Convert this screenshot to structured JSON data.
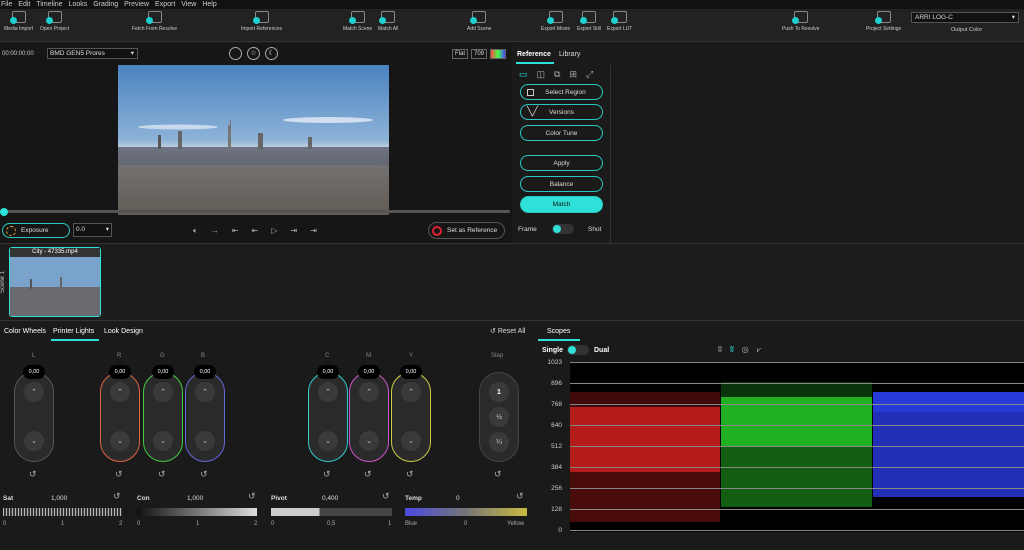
{
  "menu": [
    "File",
    "Edit",
    "Timeline",
    "Looks",
    "Grading",
    "Preview",
    "Export",
    "View",
    "Help"
  ],
  "toolbar": {
    "media_import": "Media Import",
    "open_project": "Open Project",
    "fetch": "Fetch From Resolve",
    "import_refs": "Import References",
    "match_scene": "Match Scene",
    "match_all": "Match All",
    "add_scene": "Add Scene",
    "export_movie": "Export Movie",
    "export_still": "Export Still",
    "export_lut": "Export LUT",
    "push": "Push To Resolve",
    "project_settings": "Project Settings",
    "output_color_value": "ARRI LOG-C",
    "output_color_label": "Output Color"
  },
  "viewer": {
    "timecode": "00:00:00:00",
    "format": "BMD GEN5 Prores",
    "flat": "Flat",
    "rec": "709",
    "exposure": "Exposure",
    "exposure_value": "0.0",
    "set_ref": "Set as Reference"
  },
  "ref": {
    "tab_reference": "Reference",
    "tab_library": "Library",
    "select_region": "Select Region",
    "versions": "Versions",
    "color_tune": "Color Tune",
    "apply": "Apply",
    "balance": "Balance",
    "match": "Match",
    "frame": "Frame",
    "shot": "Shot"
  },
  "clip": {
    "name": "City - 47335.mp4",
    "scene": "Scene 1"
  },
  "grading": {
    "tab_wheels": "Color Wheels",
    "tab_printer": "Printer Lights",
    "tab_look": "Look Design",
    "reset_all": "Reset All",
    "l": "L",
    "r": "R",
    "g": "G",
    "b": "B",
    "c": "C",
    "m": "M",
    "y": "Y",
    "step": "Step",
    "zero": "0,00",
    "step1": "1",
    "step2": "½",
    "step3": "¼",
    "sat": "Sat",
    "sat_val": "1,000",
    "con": "Con",
    "con_val": "1,000",
    "pivot": "Pivot",
    "pivot_val": "0,400",
    "temp": "Temp",
    "temp_val": "0",
    "t0": "0",
    "t1": "1",
    "t2": "2",
    "p0": "0",
    "p05": "0,5",
    "p1": "1",
    "blue": "Blue",
    "yellow": "Yellow"
  },
  "scopes": {
    "tab": "Scopes",
    "single": "Single",
    "dual": "Dual",
    "labels": [
      "1023",
      "896",
      "768",
      "640",
      "512",
      "384",
      "256",
      "128",
      "0"
    ]
  },
  "colors": {
    "accent": "#2ee0d8"
  }
}
